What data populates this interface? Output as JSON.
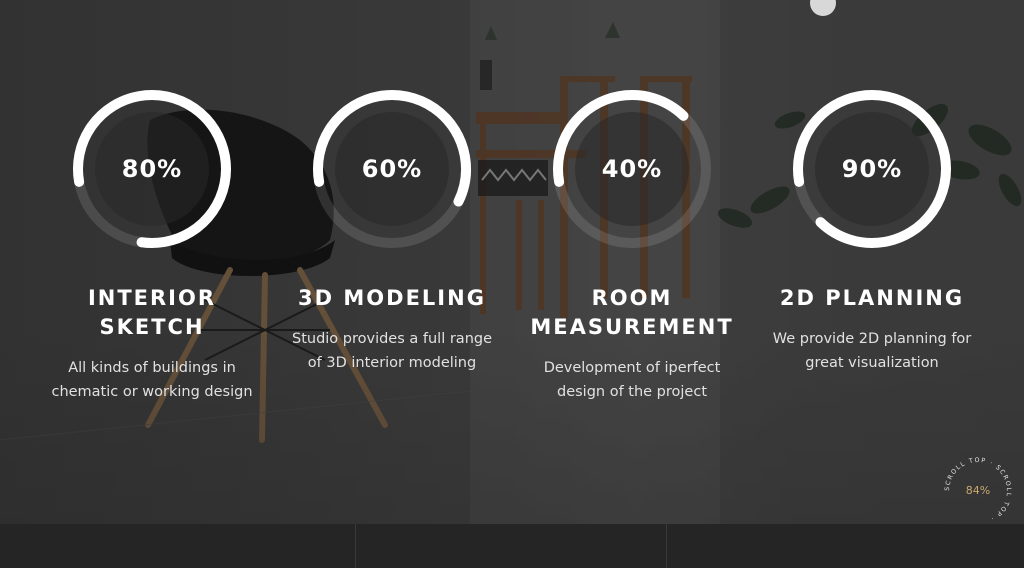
{
  "skills": [
    {
      "percent": "80%",
      "value": 0.8,
      "title_line1": "INTERIOR",
      "title_line2": "SKETCH",
      "desc_line1": "All kinds of buildings in",
      "desc_line2": "chematic or working design"
    },
    {
      "percent": "60%",
      "value": 0.6,
      "title_line1": "3D MODELING",
      "title_line2": "",
      "desc_line1": "Studio provides a full range",
      "desc_line2": "of 3D interior modeling"
    },
    {
      "percent": "40%",
      "value": 0.4,
      "title_line1": "ROOM",
      "title_line2": "MEASUREMENT",
      "desc_line1": "Development of iperfect",
      "desc_line2": "design of the project"
    },
    {
      "percent": "90%",
      "value": 0.9,
      "title_line1": "2D PLANNING",
      "title_line2": "",
      "desc_line1": "We provide 2D planning for",
      "desc_line2": "great visualization"
    }
  ],
  "scroll_top": {
    "label": "SCROLL TOP · SCROLL TOP · ",
    "percent": "84%"
  },
  "colors": {
    "ring": "#ffffff",
    "ring_track": "rgba(255,255,255,0.12)",
    "accent": "#c9a96e"
  }
}
